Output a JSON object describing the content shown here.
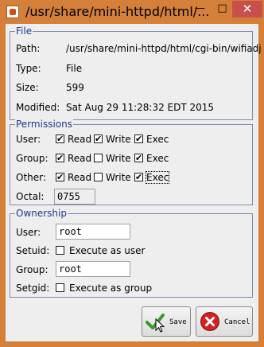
{
  "window": {
    "title": "/usr/share/mini-httpd/html/...",
    "minimize_glyph": "—",
    "maximize_glyph": "□",
    "close_glyph": "✕"
  },
  "file": {
    "legend": "File",
    "path_label": "Path:",
    "path_value": "/usr/share/mini-httpd/html/cgi-bin/wifiadj",
    "type_label": "Type:",
    "type_value": "File",
    "size_label": "Size:",
    "size_value": "599",
    "modified_label": "Modified:",
    "modified_value": "Sat Aug 29 11:28:32 EDT 2015"
  },
  "permissions": {
    "legend": "Permissions",
    "read_label": "Read",
    "write_label": "Write",
    "exec_label": "Exec",
    "rows": [
      {
        "label": "User:",
        "read": true,
        "write": true,
        "exec": true
      },
      {
        "label": "Group:",
        "read": true,
        "write": false,
        "exec": true
      },
      {
        "label": "Other:",
        "read": true,
        "write": false,
        "exec": true
      }
    ],
    "octal_label": "Octal:",
    "octal_value": "0755"
  },
  "ownership": {
    "legend": "Ownership",
    "user_label": "User:",
    "user_value": "root",
    "setuid_label": "Setuid:",
    "setuid_checkbox_label": "Execute as user",
    "setuid_checked": false,
    "group_label": "Group:",
    "group_value": "root",
    "setgid_label": "Setgid:",
    "setgid_checkbox_label": "Execute as group",
    "setgid_checked": false
  },
  "buttons": {
    "save_label": "Save",
    "cancel_label": "Cancel"
  },
  "check_glyph": "✔",
  "colors": {
    "titlebar": "#d4803a",
    "close_button": "#c7504a",
    "legend_text": "#1e3a8a",
    "group_border": "#7a8ab0",
    "save_check": "#3a9a2a",
    "cancel_circle": "#d42020"
  }
}
